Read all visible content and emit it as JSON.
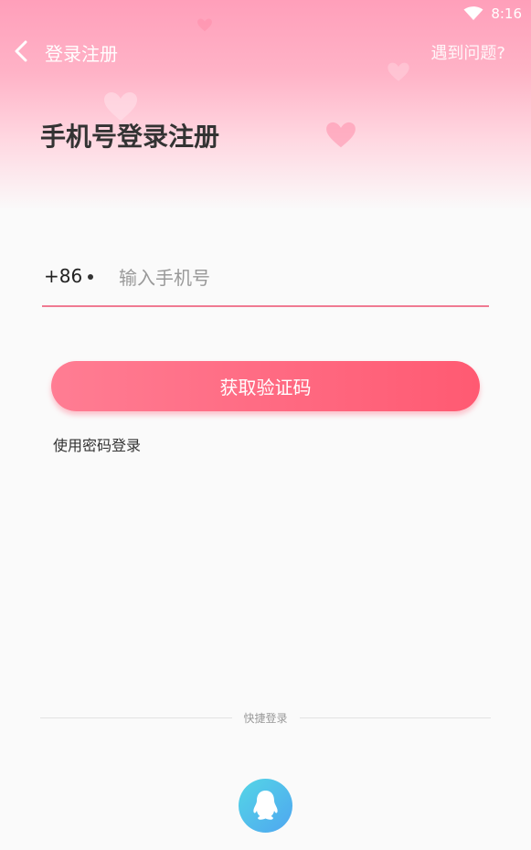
{
  "status_bar": {
    "time": "8:16"
  },
  "nav": {
    "title": "登录注册",
    "help_label": "遇到问题?"
  },
  "page": {
    "title": "手机号登录注册"
  },
  "phone": {
    "country_code": "+86",
    "value": "",
    "placeholder": "输入手机号"
  },
  "actions": {
    "get_code_label": "获取验证码",
    "password_login_label": "使用密码登录"
  },
  "quick_login": {
    "label": "快捷登录"
  },
  "colors": {
    "accent": "#ff6b83",
    "underline": "#f07a92",
    "header_pink": "#ff9fba",
    "qq_gradient_start": "#54d6e6",
    "qq_gradient_end": "#4fa6f0"
  },
  "icons": {
    "back": "chevron-left-icon",
    "wifi": "wifi-icon",
    "qq": "qq-penguin-icon"
  }
}
